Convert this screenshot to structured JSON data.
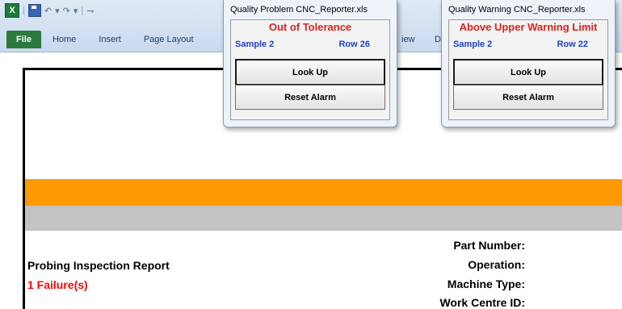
{
  "ribbon": {
    "qat_glyphs": {
      "undo": "↶",
      "undo_dropdown": "▾",
      "redo": "↷",
      "redo_dropdown": "▾",
      "customize": "⇁",
      "separator": "|"
    },
    "tabs": {
      "file": "File",
      "home": "Home",
      "insert": "Insert",
      "page_layout": "Page Layout",
      "view_partial": "iew",
      "d_partial": "D"
    }
  },
  "popup_problem": {
    "title": "Quality Problem CNC_Reporter.xls",
    "alarm": "Out of Tolerance",
    "sample_label": "Sample 2",
    "row_label": "Row  26",
    "lookup_label": "Look Up",
    "reset_label": "Reset Alarm"
  },
  "popup_warning": {
    "title": "Quality Warning CNC_Reporter.xls",
    "alarm": "Above Upper Warning Limit",
    "sample_label": "Sample 2",
    "row_label": "Row  22",
    "lookup_label": "Look Up",
    "reset_label": "Reset Alarm"
  },
  "report": {
    "title": "Probing Inspection Report",
    "failures": "1 Failure(s)",
    "fields": {
      "part_number": "Part Number:",
      "operation": "Operation:",
      "machine_type": "Machine Type:",
      "work_centre": "Work Centre ID:"
    }
  },
  "colors": {
    "orange_band": "#ff9900",
    "gray_band": "#c3c3c3",
    "alarm_red": "#e0201a",
    "sample_blue": "#1f3fcf",
    "file_tab": "#2a7a3b"
  }
}
